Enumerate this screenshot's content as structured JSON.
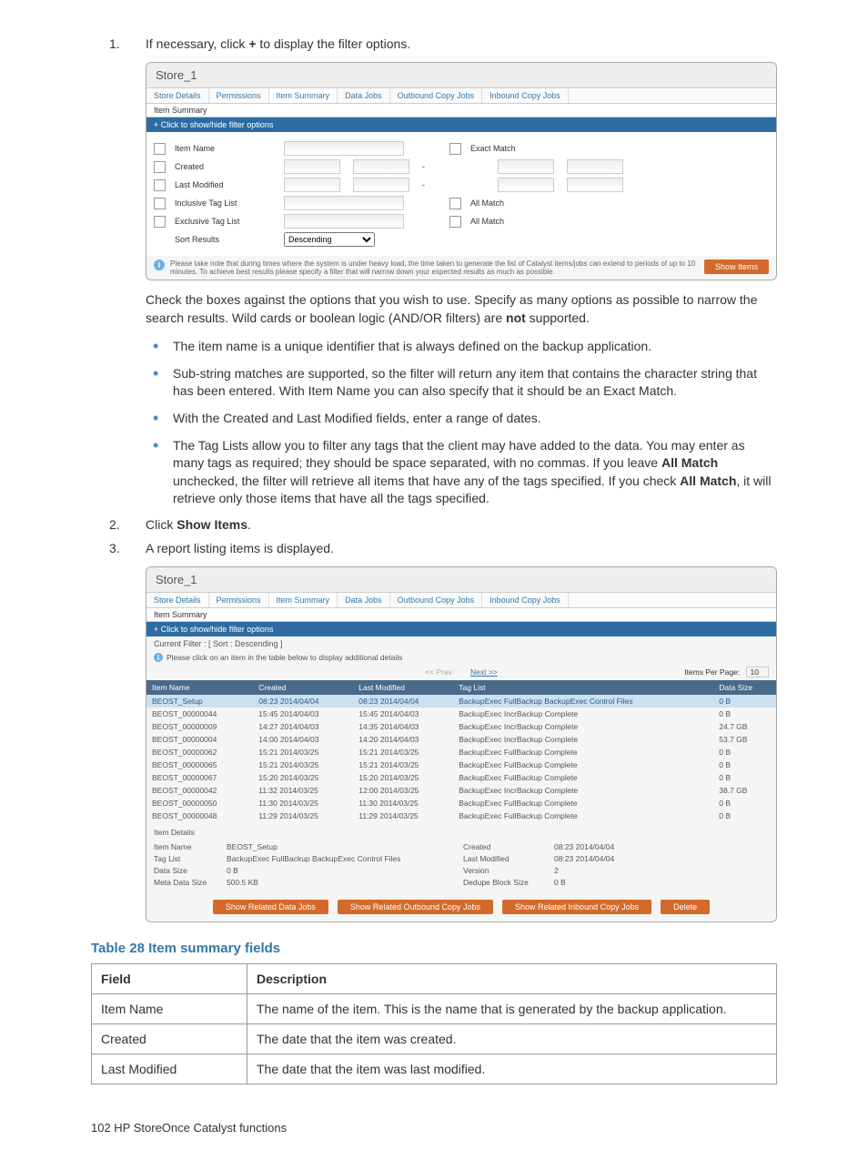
{
  "step1": {
    "num": "1.",
    "text_before": "If necessary, click ",
    "plus": "+",
    "text_after": " to display the filter options."
  },
  "ss1": {
    "title": "Store_1",
    "tabs": [
      "Store Details",
      "Permissions",
      "Item Summary",
      "Data Jobs",
      "Outbound Copy Jobs",
      "Inbound Copy Jobs"
    ],
    "subtab": "Item Summary",
    "filter_toggle": "+ Click to show/hide filter options",
    "rows": {
      "item_name": "Item Name",
      "created": "Created",
      "last_modified": "Last Modified",
      "inclusive": "Inclusive Tag List",
      "exclusive": "Exclusive Tag List",
      "sort": "Sort Results"
    },
    "exact_match": "Exact Match",
    "all_match": "All Match",
    "sort_value": "Descending",
    "note": "Please take note that during times where the system is under heavy load, the time taken to generate the list of Catalyst items/jobs can extend to periods of up to 10 minutes. To achieve best results please specify a filter that will narrow down your expected results as much as possible.",
    "show_btn": "Show Items"
  },
  "para1": {
    "t1": "Check the boxes against the options that you wish to use. Specify as many options as possible to narrow the search results. Wild cards or boolean logic (AND/OR filters) are ",
    "b1": "not",
    "t2": " supported."
  },
  "bullets": {
    "b1": "The item name is a unique identifier that is always defined on the backup application.",
    "b2": "Sub-string matches are supported, so the filter will return any item that contains the character string that has been entered. With Item Name you can also specify that it should be an Exact Match.",
    "b3": "With the Created and Last Modified fields, enter a range of dates.",
    "b4_t1": "The Tag Lists allow you to filter any tags that the client may have added to the data. You may enter as many tags as required; they should be space separated, with no commas. If you leave ",
    "b4_b1": "All Match",
    "b4_t2": " unchecked, the filter will retrieve all items that have any of the tags specified. If you check ",
    "b4_b2": "All Match",
    "b4_t3": ", it will retrieve only those items that have all the tags specified."
  },
  "step2": {
    "num": "2.",
    "t1": "Click ",
    "b1": "Show Items",
    "t2": "."
  },
  "step3": {
    "num": "3.",
    "t1": "A report listing items is displayed."
  },
  "ss2": {
    "title": "Store_1",
    "tabs": [
      "Store Details",
      "Permissions",
      "Item Summary",
      "Data Jobs",
      "Outbound Copy Jobs",
      "Inbound Copy Jobs"
    ],
    "subtab": "Item Summary",
    "filter_toggle": "+ Click to show/hide filter options",
    "current_filter": "Current Filter : [ Sort : Descending ]",
    "hint": "Please click on an item in the table below to display additional details",
    "prev": "<< Prev",
    "next": "Next >>",
    "ipp_label": "Items Per Page:",
    "ipp_value": "10",
    "cols": [
      "Item Name",
      "Created",
      "Last Modified",
      "Tag List",
      "Data Size"
    ],
    "rows": [
      {
        "n": "BEOST_Setup",
        "c": "08:23 2014/04/04",
        "m": "08:23 2014/04/04",
        "t": "BackupExec FullBackup BackupExec Control Files",
        "s": "0 B",
        "sel": true
      },
      {
        "n": "BEOST_00000044",
        "c": "15:45 2014/04/03",
        "m": "15:45 2014/04/03",
        "t": "BackupExec IncrBackup Complete",
        "s": "0 B"
      },
      {
        "n": "BEOST_00000009",
        "c": "14:27 2014/04/03",
        "m": "14:35 2014/04/03",
        "t": "BackupExec IncrBackup Complete",
        "s": "24.7 GB"
      },
      {
        "n": "BEOST_00000004",
        "c": "14:00 2014/04/03",
        "m": "14:20 2014/04/03",
        "t": "BackupExec IncrBackup Complete",
        "s": "53.7 GB"
      },
      {
        "n": "BEOST_00000062",
        "c": "15:21 2014/03/25",
        "m": "15:21 2014/03/25",
        "t": "BackupExec FullBackup Complete",
        "s": "0 B"
      },
      {
        "n": "BEOST_00000065",
        "c": "15:21 2014/03/25",
        "m": "15:21 2014/03/25",
        "t": "BackupExec FullBackup Complete",
        "s": "0 B"
      },
      {
        "n": "BEOST_00000067",
        "c": "15:20 2014/03/25",
        "m": "15:20 2014/03/25",
        "t": "BackupExec FullBackup Complete",
        "s": "0 B"
      },
      {
        "n": "BEOST_00000042",
        "c": "11:32 2014/03/25",
        "m": "12:00 2014/03/25",
        "t": "BackupExec IncrBackup Complete",
        "s": "38.7 GB"
      },
      {
        "n": "BEOST_00000050",
        "c": "11:30 2014/03/25",
        "m": "11:30 2014/03/25",
        "t": "BackupExec FullBackup Complete",
        "s": "0 B"
      },
      {
        "n": "BEOST_00000048",
        "c": "11:29 2014/03/25",
        "m": "11:29 2014/03/25",
        "t": "BackupExec FullBackup Complete",
        "s": "0 B"
      }
    ],
    "details_header": "Item Details",
    "details": {
      "item_name_l": "Item Name",
      "item_name_v": "BEOST_Setup",
      "tag_l": "Tag List",
      "tag_v": "BackupExec FullBackup BackupExec Control Files",
      "ds_l": "Data Size",
      "ds_v": "0 B",
      "mds_l": "Meta Data Size",
      "mds_v": "500.5 KB",
      "created_l": "Created",
      "created_v": "08:23 2014/04/04",
      "lm_l": "Last Modified",
      "lm_v": "08:23 2014/04/04",
      "ver_l": "Version",
      "ver_v": "2",
      "dbs_l": "Dedupe Block Size",
      "dbs_v": "0 B"
    },
    "actions": [
      "Show Related Data Jobs",
      "Show Related Outbound Copy Jobs",
      "Show Related Inbound Copy Jobs",
      "Delete"
    ]
  },
  "table28": {
    "title": "Table 28 Item summary fields",
    "head_field": "Field",
    "head_desc": "Description",
    "rows": [
      {
        "f": "Item Name",
        "d": "The name of the item. This is the name that is generated by the backup application."
      },
      {
        "f": "Created",
        "d": "The date that the item was created."
      },
      {
        "f": "Last Modified",
        "d": "The date that the item was last modified."
      }
    ]
  },
  "footer": "102   HP StoreOnce Catalyst functions"
}
